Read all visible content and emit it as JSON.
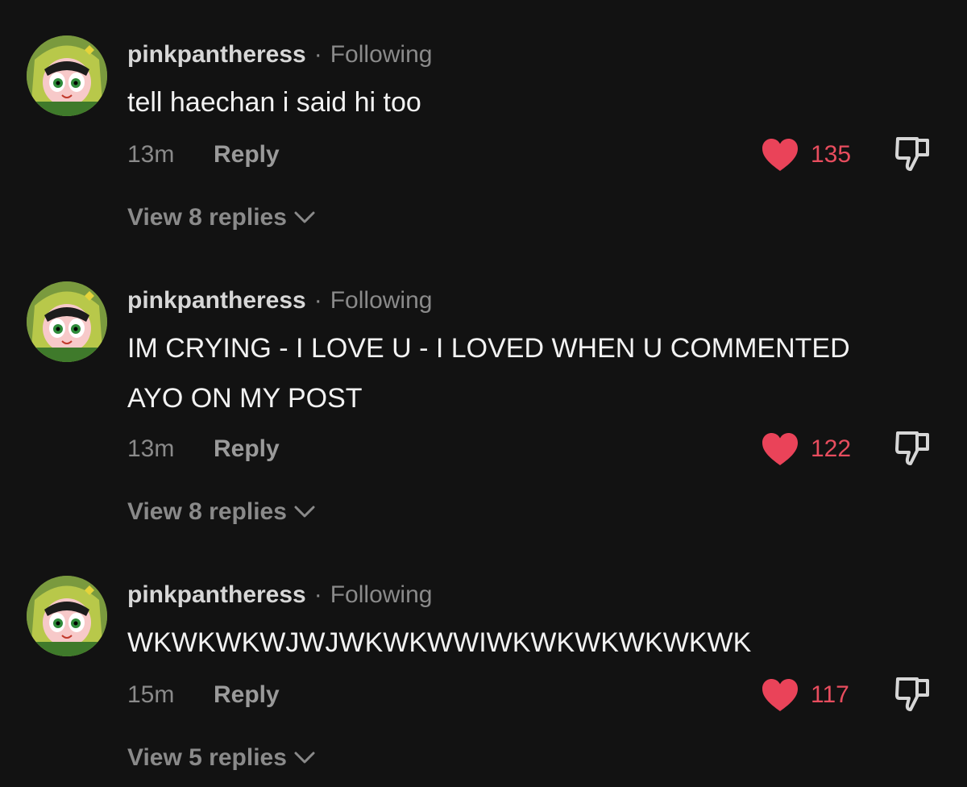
{
  "comments": [
    {
      "username": "pinkpantheress",
      "separator": "·",
      "status": "Following",
      "text": "tell haechan i said hi too",
      "time": "13m",
      "reply_label": "Reply",
      "likes": "135",
      "view_replies": "View 8 replies"
    },
    {
      "username": "pinkpantheress",
      "separator": "·",
      "status": "Following",
      "text": "IM CRYING - I LOVE U - I LOVED WHEN U COMMENTED AYO ON MY POST",
      "time": "13m",
      "reply_label": "Reply",
      "likes": "122",
      "view_replies": "View 8 replies"
    },
    {
      "username": "pinkpantheress",
      "separator": "·",
      "status": "Following",
      "text": "WKWKWKWJWJWKWKWWIWKWKWKWKWKWK",
      "time": "15m",
      "reply_label": "Reply",
      "likes": "117",
      "view_replies": "View 5 replies"
    }
  ],
  "icons": {
    "like": "heart-icon",
    "dislike": "thumbs-down-icon",
    "expand": "chevron-down-icon"
  },
  "colors": {
    "background": "#121212",
    "like_accent": "#e84d5e",
    "secondary_text": "#8a8a8a"
  }
}
